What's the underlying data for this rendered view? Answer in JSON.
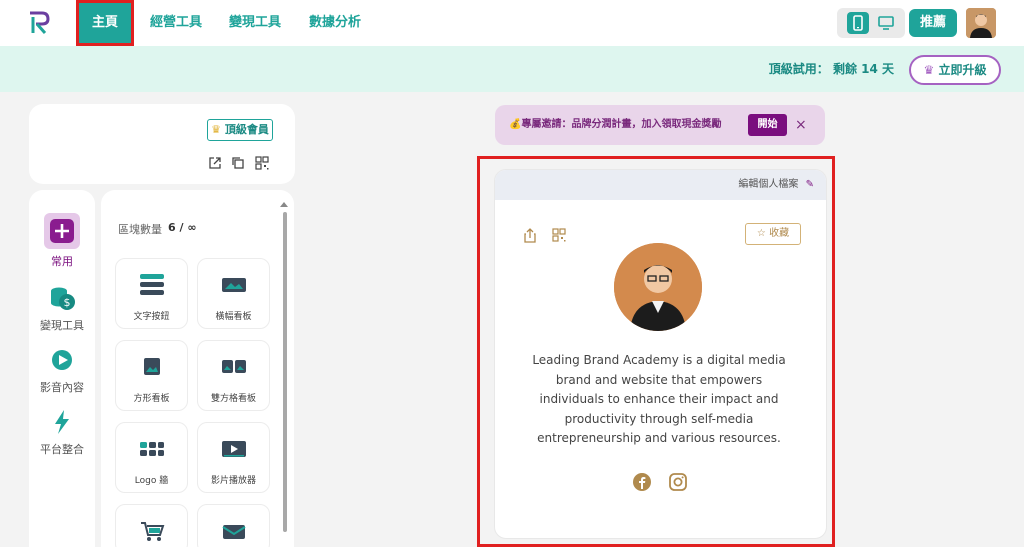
{
  "nav": {
    "items": [
      {
        "label": "主頁",
        "active": true
      },
      {
        "label": "經營工具"
      },
      {
        "label": "變現工具"
      },
      {
        "label": "數據分析"
      }
    ],
    "publish_label": "推薦",
    "accent_color": "#1fa49a"
  },
  "trial": {
    "text": "頂級試用： 剩餘 14 天",
    "upgrade_label": "立即升級"
  },
  "account": {
    "badge_label": "頂級會員"
  },
  "side_menu": {
    "items": [
      {
        "label": "常用",
        "icon": "plus-icon",
        "active": true
      },
      {
        "label": "變現工具",
        "icon": "coins-icon"
      },
      {
        "label": "影音內容",
        "icon": "play-icon"
      },
      {
        "label": "平台整合",
        "icon": "bolt-icon"
      }
    ]
  },
  "blocks": {
    "count_label": "區塊數量",
    "count_value": "6 / ∞",
    "tiles": [
      {
        "label": "文字按鈕",
        "icon": "text-button-icon"
      },
      {
        "label": "橫幅看板",
        "icon": "banner-icon"
      },
      {
        "label": "方形看板",
        "icon": "square-board-icon"
      },
      {
        "label": "雙方格看板",
        "icon": "dual-grid-icon"
      },
      {
        "label": "Logo 牆",
        "icon": "logo-wall-icon"
      },
      {
        "label": "影片播放器",
        "icon": "video-player-icon"
      },
      {
        "label": "",
        "icon": "cart-icon"
      },
      {
        "label": "",
        "icon": "mail-icon"
      }
    ]
  },
  "invite": {
    "text": "💰專屬邀請：品牌分潤計畫，加入領取現金獎勵",
    "start_label": "開始",
    "close_label": "×"
  },
  "preview": {
    "edit_label": "編輯個人檔案",
    "favorite_label": "收藏",
    "bio": "Leading Brand Academy is a digital media brand and website that empowers individuals to enhance their impact and productivity through self-media entrepreneurship and various resources."
  }
}
